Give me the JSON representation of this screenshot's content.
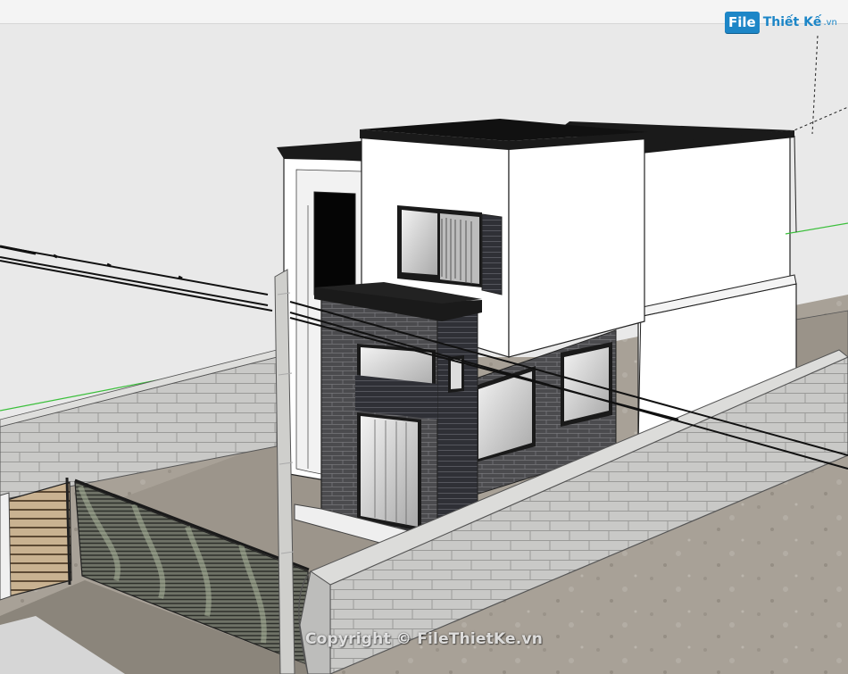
{
  "watermark": {
    "logo_mark": "File",
    "logo_text": "Thiết Kế",
    "logo_domain": ".vn",
    "copyright": "Copyright © FileThietKe.vn"
  },
  "colors": {
    "sky": "#e9e9e9",
    "ground": "#a9a298",
    "wall_block": "#c8c8c6",
    "roof": "#1a1a1a",
    "facade_white": "#ffffff",
    "brick_dark": "#4a4a4c",
    "brand_blue": "#1d86c7",
    "axis_green": "#3bbf3b"
  }
}
